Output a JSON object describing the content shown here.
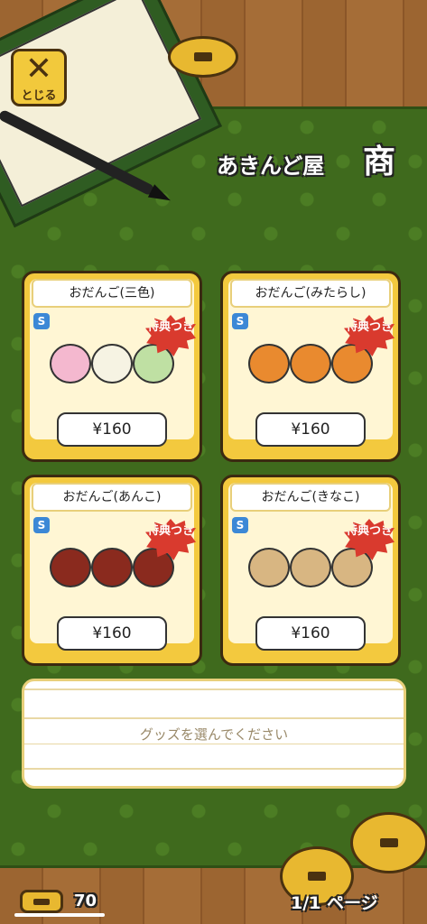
{
  "header": {
    "close_label": "とじる",
    "shop_title": "あきんど屋",
    "shop_logo": "商"
  },
  "products": [
    {
      "name": "おだんご(三色)",
      "price": "¥160",
      "badge": "S",
      "tag": "特典つき",
      "colors": [
        "#f4b8cf",
        "#f6f3e3",
        "#bfe0a3"
      ]
    },
    {
      "name": "おだんご(みたらし)",
      "price": "¥160",
      "badge": "S",
      "tag": "特典つき",
      "colors": [
        "#e98a2f",
        "#e98a2f",
        "#e98a2f"
      ]
    },
    {
      "name": "おだんご(あんこ)",
      "price": "¥160",
      "badge": "S",
      "tag": "特典つき",
      "colors": [
        "#8a2a1e",
        "#8a2a1e",
        "#8a2a1e"
      ]
    },
    {
      "name": "おだんご(きなこ)",
      "price": "¥160",
      "badge": "S",
      "tag": "特典つき",
      "colors": [
        "#d8b682",
        "#d8b682",
        "#d8b682"
      ]
    }
  ],
  "description": {
    "placeholder": "グッズを選んでください"
  },
  "footer": {
    "coins": "70",
    "page": "1/1 ページ"
  }
}
